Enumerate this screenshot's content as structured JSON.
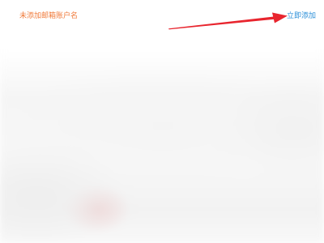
{
  "notice": {
    "message": "未添加邮箱账户名",
    "action_label": "立即添加"
  },
  "colors": {
    "message": "#f07a3a",
    "action": "#2b8fd8",
    "arrow": "#e8252e",
    "background": "#ffffff"
  },
  "annotation": {
    "icon": "red-arrow-icon"
  }
}
